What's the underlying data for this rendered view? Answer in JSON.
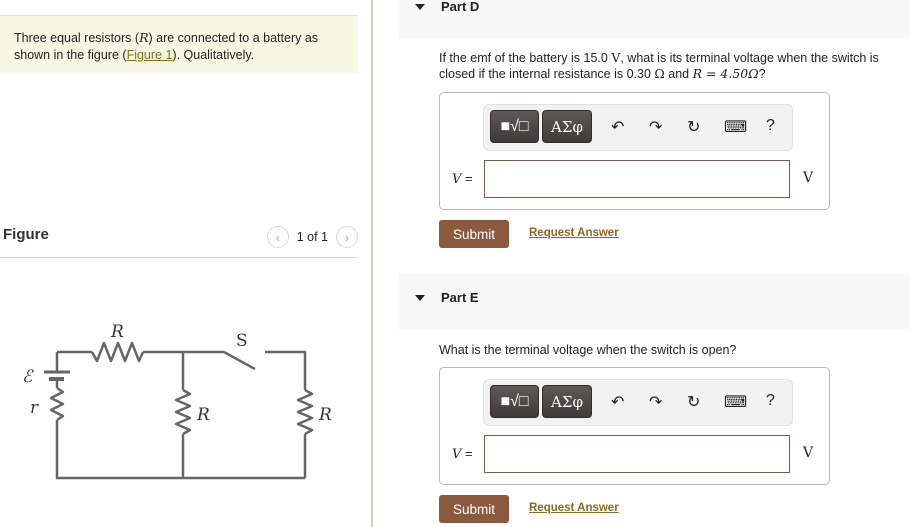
{
  "intro": {
    "text_before": "Three equal resistors (",
    "var": "R",
    "text_middle": ") are connected to a battery as shown in the figure (",
    "link": "Figure 1",
    "text_after": "). Qualitatively."
  },
  "figure": {
    "title": "Figure",
    "pager_text": "1 of 1",
    "prev_icon": "‹",
    "next_icon": "›",
    "labels": {
      "top_resistor": "R",
      "switch": "S",
      "emf": "ℰ",
      "internal": "r",
      "middle_resistor": "R",
      "right_resistor": "R"
    }
  },
  "parts": [
    {
      "title": "Part D",
      "question": {
        "p1": "If the emf of the battery is 15.0 ",
        "v_unit": "V",
        "p2": ", what is its terminal voltage when the switch is closed if the internal resistance is 0.30 ",
        "omega": "Ω",
        "p3": " and ",
        "r_eq": "R = 4.50Ω",
        "p4": "?"
      },
      "toolbar": {
        "templates": "■√□",
        "symbols": "ΑΣφ",
        "undo": "↶",
        "redo": "↷",
        "reset": "↻",
        "keyboard": "⌨",
        "help": "?"
      },
      "var_label": "V",
      "equals": "=",
      "input_value": "",
      "unit": "V",
      "submit": "Submit",
      "request": "Request Answer"
    },
    {
      "title": "Part E",
      "question": {
        "p1": "What is the terminal voltage when the switch is open?"
      },
      "toolbar": {
        "templates": "■√□",
        "symbols": "ΑΣφ",
        "undo": "↶",
        "redo": "↷",
        "reset": "↻",
        "keyboard": "⌨",
        "help": "?"
      },
      "var_label": "V",
      "equals": "=",
      "input_value": "",
      "unit": "V",
      "submit": "Submit",
      "request": "Request Answer"
    }
  ]
}
